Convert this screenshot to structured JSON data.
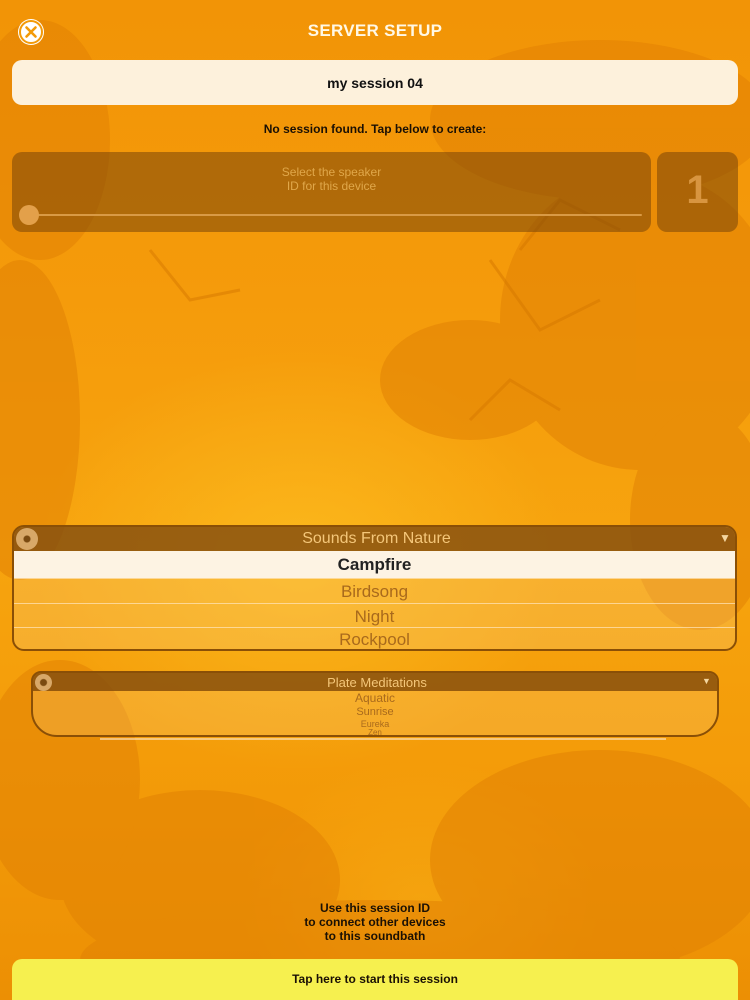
{
  "header": {
    "title": "SERVER SETUP",
    "close_icon": "close-icon"
  },
  "session": {
    "name_value": "my session 04",
    "status": "No session found. Tap below to create:"
  },
  "speaker": {
    "caption": "Select the speaker\nID for this device",
    "id_value": "1",
    "slider_value": 1
  },
  "sounds_picker": {
    "title": "Sounds From Nature",
    "selected": "Campfire",
    "items": [
      "Birdsong",
      "Night",
      "Rockpool"
    ]
  },
  "plate_picker": {
    "title": "Plate Meditations",
    "items": [
      "Aquatic",
      "Sunrise",
      "Eureka",
      "Zen"
    ]
  },
  "footer": {
    "help_text": "Use this session ID\nto connect other devices\nto this soundbath",
    "start_label": "Tap here to start this session"
  },
  "colors": {
    "background": "#f39a08",
    "start_button": "#f6f04f",
    "panel": "#784610"
  }
}
